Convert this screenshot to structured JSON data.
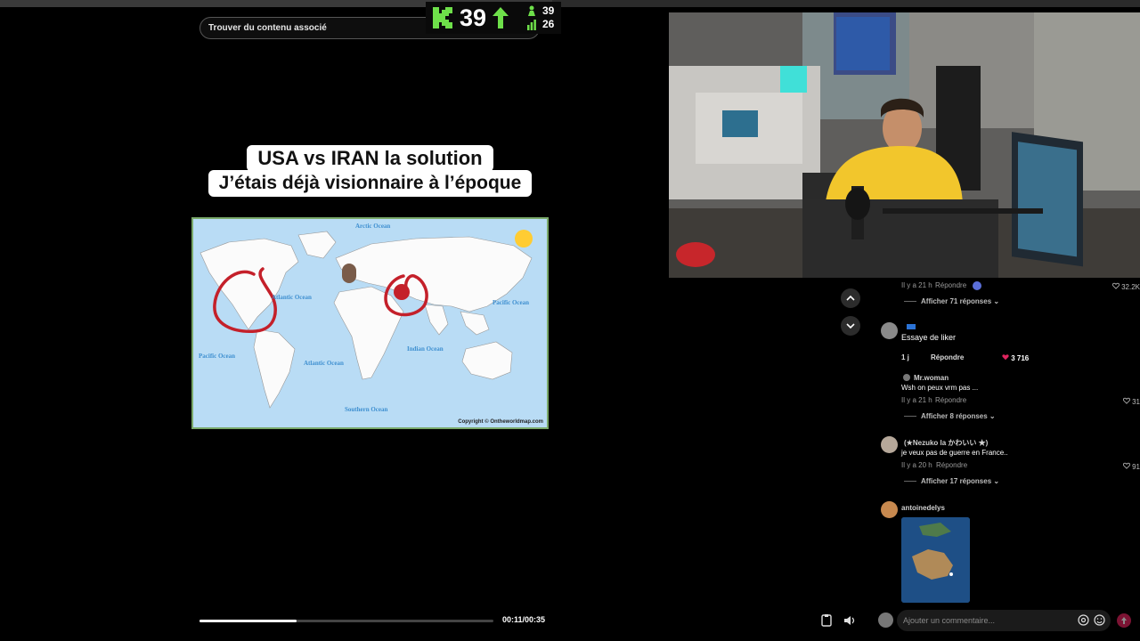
{
  "video": {
    "search_placeholder": "Trouver du contenu associé",
    "caption_line1": "USA vs IRAN la solution",
    "caption_line2": "J’étais déjà visionnaire à l’époque",
    "map_labels": {
      "arctic": "Arctic Ocean",
      "atlantic_n": "Atlantic Ocean",
      "pacific_e": "Pacific Ocean",
      "pacific_w": "Pacific Ocean",
      "atlantic_s": "Atlantic Ocean",
      "indian": "Indian Ocean",
      "southern": "Southern Ocean",
      "copyright": "Copyright © Ontheworldmap.com"
    },
    "progress_fraction": 0.33,
    "time": "00:11/00:35"
  },
  "overlay": {
    "count": "39",
    "top_num": "39",
    "bottom_num": "26",
    "accent": "#6ee04a"
  },
  "comments": {
    "c1": {
      "meta": "Il y a 21 h",
      "reply": "Répondre",
      "likes": "32.2K",
      "show_replies": "Afficher 71 réponses"
    },
    "c2": {
      "name": "",
      "text": "Essaye de liker",
      "meta": "1 j",
      "reply": "Répondre",
      "likes": "3 716"
    },
    "c2_reply": {
      "name": "Mr.woman",
      "text": "Wsh on peux vrm pas ...",
      "meta": "Il y a 21 h",
      "reply": "Répondre",
      "likes": "31",
      "show_replies": "Afficher 8 réponses"
    },
    "c3": {
      "name": "(★Nezuko la かわいい ★)",
      "text": "je veux pas de guerre en France..",
      "meta": "Il y a 20 h",
      "reply": "Répondre",
      "likes": "91",
      "show_replies": "Afficher 17 réponses"
    },
    "c4": {
      "name": "antoinedelys"
    }
  },
  "composer": {
    "placeholder": "Ajouter un commentaire..."
  },
  "colors": {
    "like_red": "#e0245e",
    "map_ocean": "#b9dcf5",
    "annotation_red": "#c4202a"
  }
}
